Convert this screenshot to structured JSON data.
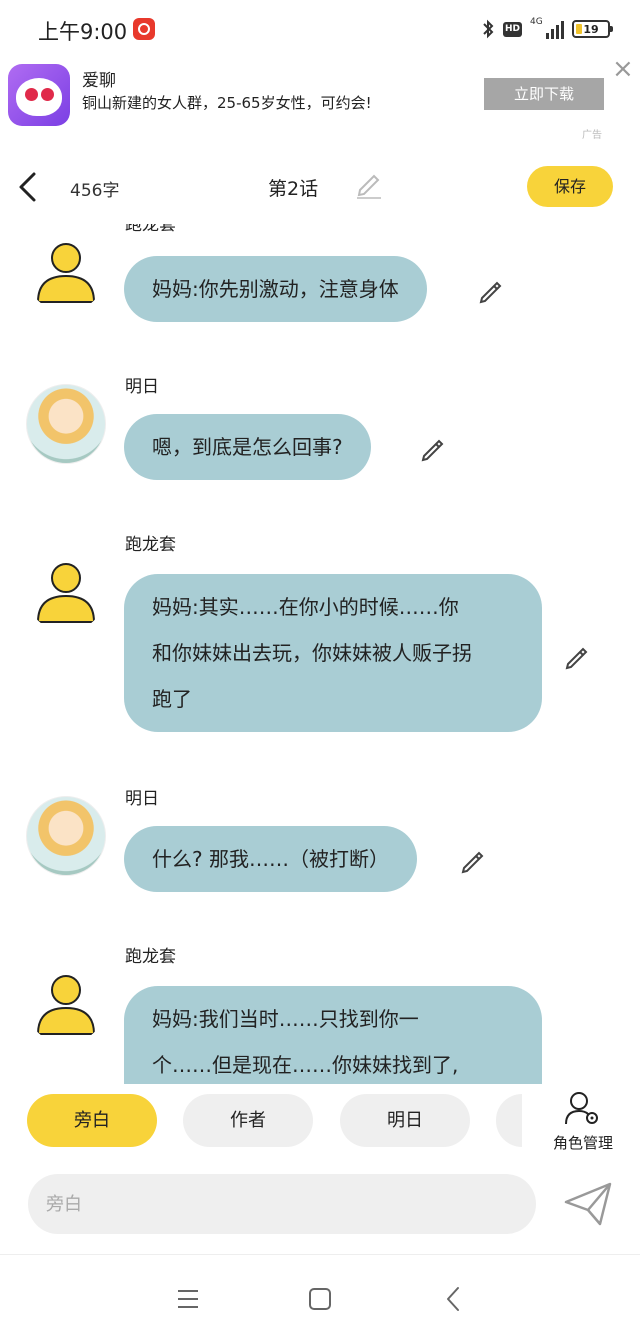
{
  "status": {
    "time": "上午9:00",
    "hd": "HD",
    "network": "4G",
    "battery": "19",
    "battery_fraction": 0.19
  },
  "ad": {
    "title": "爱聊",
    "desc": "铜山新建的女人群，25-65岁女性，可约会!",
    "button": "立即下载",
    "mark": "广告"
  },
  "header": {
    "char_count": "456字",
    "chapter": "第2话",
    "save": "保存"
  },
  "messages": [
    {
      "sender": "跑龙套",
      "avatar": "default-person-icon",
      "text": [
        "妈妈:你先别激动，注意身体"
      ]
    },
    {
      "sender": "明日",
      "avatar": "anime-girl-avatar",
      "text": [
        "嗯，到底是怎么回事?"
      ]
    },
    {
      "sender": "跑龙套",
      "avatar": "default-person-icon",
      "text": [
        "妈妈:其实……在你小的时候……你",
        "和你妹妹出去玩，你妹妹被人贩子拐",
        "跑了"
      ]
    },
    {
      "sender": "明日",
      "avatar": "anime-girl-avatar",
      "text": [
        "什么? 那我……（被打断）"
      ]
    },
    {
      "sender": "跑龙套",
      "avatar": "default-person-icon",
      "text": [
        "妈妈:我们当时……只找到你一",
        "个……但是现在……你妹妹找到了,"
      ]
    }
  ],
  "roles": {
    "chips": [
      "旁白",
      "作者",
      "明日"
    ],
    "manage": "角色管理"
  },
  "input": {
    "placeholder": "旁白"
  },
  "colors": {
    "accent": "#f8d33a",
    "bubble": "#a9cdd4"
  }
}
